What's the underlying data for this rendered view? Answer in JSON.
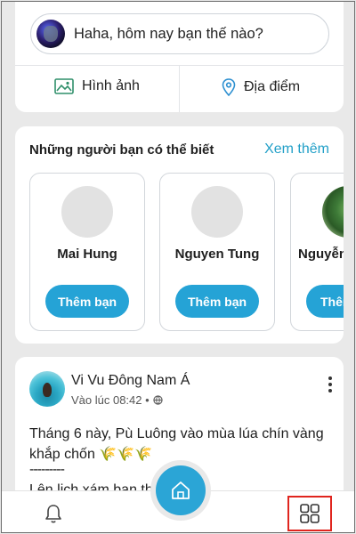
{
  "composer": {
    "prompt": "Haha, hôm nay bạn thế nào?",
    "photo_label": "Hình ảnh",
    "place_label": "Địa điểm"
  },
  "suggestions": {
    "title": "Những người bạn có thể biết",
    "see_more": "Xem thêm",
    "people": [
      {
        "name": "Mai Hung",
        "button": "Thêm bạn"
      },
      {
        "name": "Nguyen Tung",
        "button": "Thêm bạn"
      },
      {
        "name": "Nguyễn",
        "button": "Thêm"
      }
    ]
  },
  "post": {
    "author": "Vi Vu Đông Nam Á",
    "time": "Vào lúc 08:42 •",
    "line1": "Tháng 6 này, Pù Luông vào mùa lúa chín vàng",
    "line2": "khắp chốn",
    "emoji": "🌾🌾🌾",
    "line3": "---------",
    "line4": "Lên lịch xám bạn th"
  },
  "colors": {
    "accent": "#25a3d6",
    "highlight_box": "#e0251e"
  },
  "icons": {
    "photo": "image-icon",
    "place": "location-pin-icon",
    "bell": "bell-icon",
    "home": "home-icon",
    "grid": "grid-icon",
    "globe": "globe-icon",
    "more": "more-vertical-icon"
  }
}
